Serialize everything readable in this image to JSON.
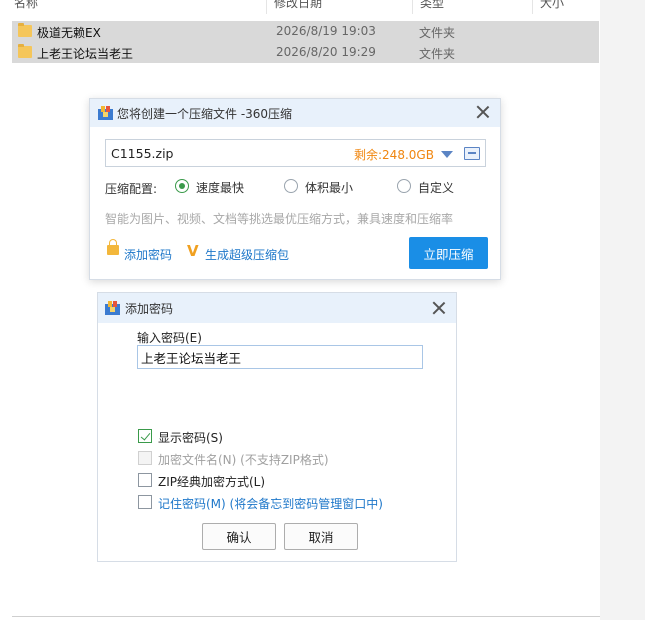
{
  "explorer": {
    "columns": {
      "name": "名称",
      "date": "修改日期",
      "type": "类型",
      "size": "大小"
    },
    "rows": [
      {
        "name": "极道无赖EX",
        "date": "2026/8/19 19:03",
        "type": "文件夹"
      },
      {
        "name": "上老王论坛当老王",
        "date": "2026/8/20 19:29",
        "type": "文件夹"
      }
    ]
  },
  "zip_dialog": {
    "title": "您将创建一个压缩文件 -360压缩",
    "filename": "C1155.zip",
    "free_space": "剩余:248.0GB",
    "config_label": "压缩配置:",
    "options": [
      "速度最快",
      "体积最小",
      "自定义"
    ],
    "selected_option": "速度最快",
    "hint": "智能为图片、视频、文档等挑选最优压缩方式，兼具速度和压缩率",
    "add_password": "添加密码",
    "super_pack": "生成超级压缩包",
    "compress_button": "立即压缩",
    "colors": {
      "accent": "#1a8ee6",
      "free_space": "#f0860f",
      "link": "#1e77c9"
    }
  },
  "password_dialog": {
    "title": "添加密码",
    "input_label": "输入密码(E)",
    "password_value": "上老王论坛当老王",
    "show_password": {
      "label": "显示密码(S)",
      "checked": true
    },
    "encrypt_filenames": {
      "label": "加密文件名(N) (不支持ZIP格式)",
      "checked": false,
      "disabled": true
    },
    "zip_classic": {
      "label": "ZIP经典加密方式(L)",
      "checked": false
    },
    "remember": {
      "label": "记住密码(M) (将会备忘到密码管理窗口中)",
      "checked": false
    },
    "ok": "确认",
    "cancel": "取消"
  }
}
